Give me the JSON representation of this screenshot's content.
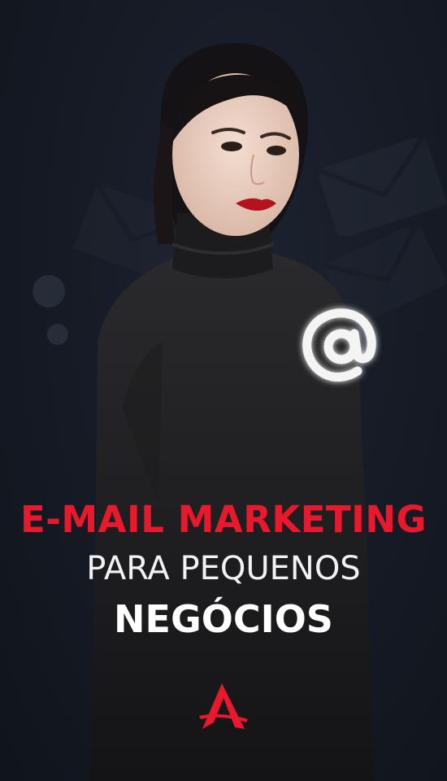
{
  "headline": "E-MAIL MARKETING",
  "subline": "PARA PEQUENOS",
  "subline_bold": "NEGÓCIOS",
  "icons": [
    "envelope-icon",
    "at-sign-icon",
    "brand-logo-icon"
  ],
  "colors": {
    "background": "#141820",
    "accent": "#e8192c",
    "text": "#ffffff"
  }
}
